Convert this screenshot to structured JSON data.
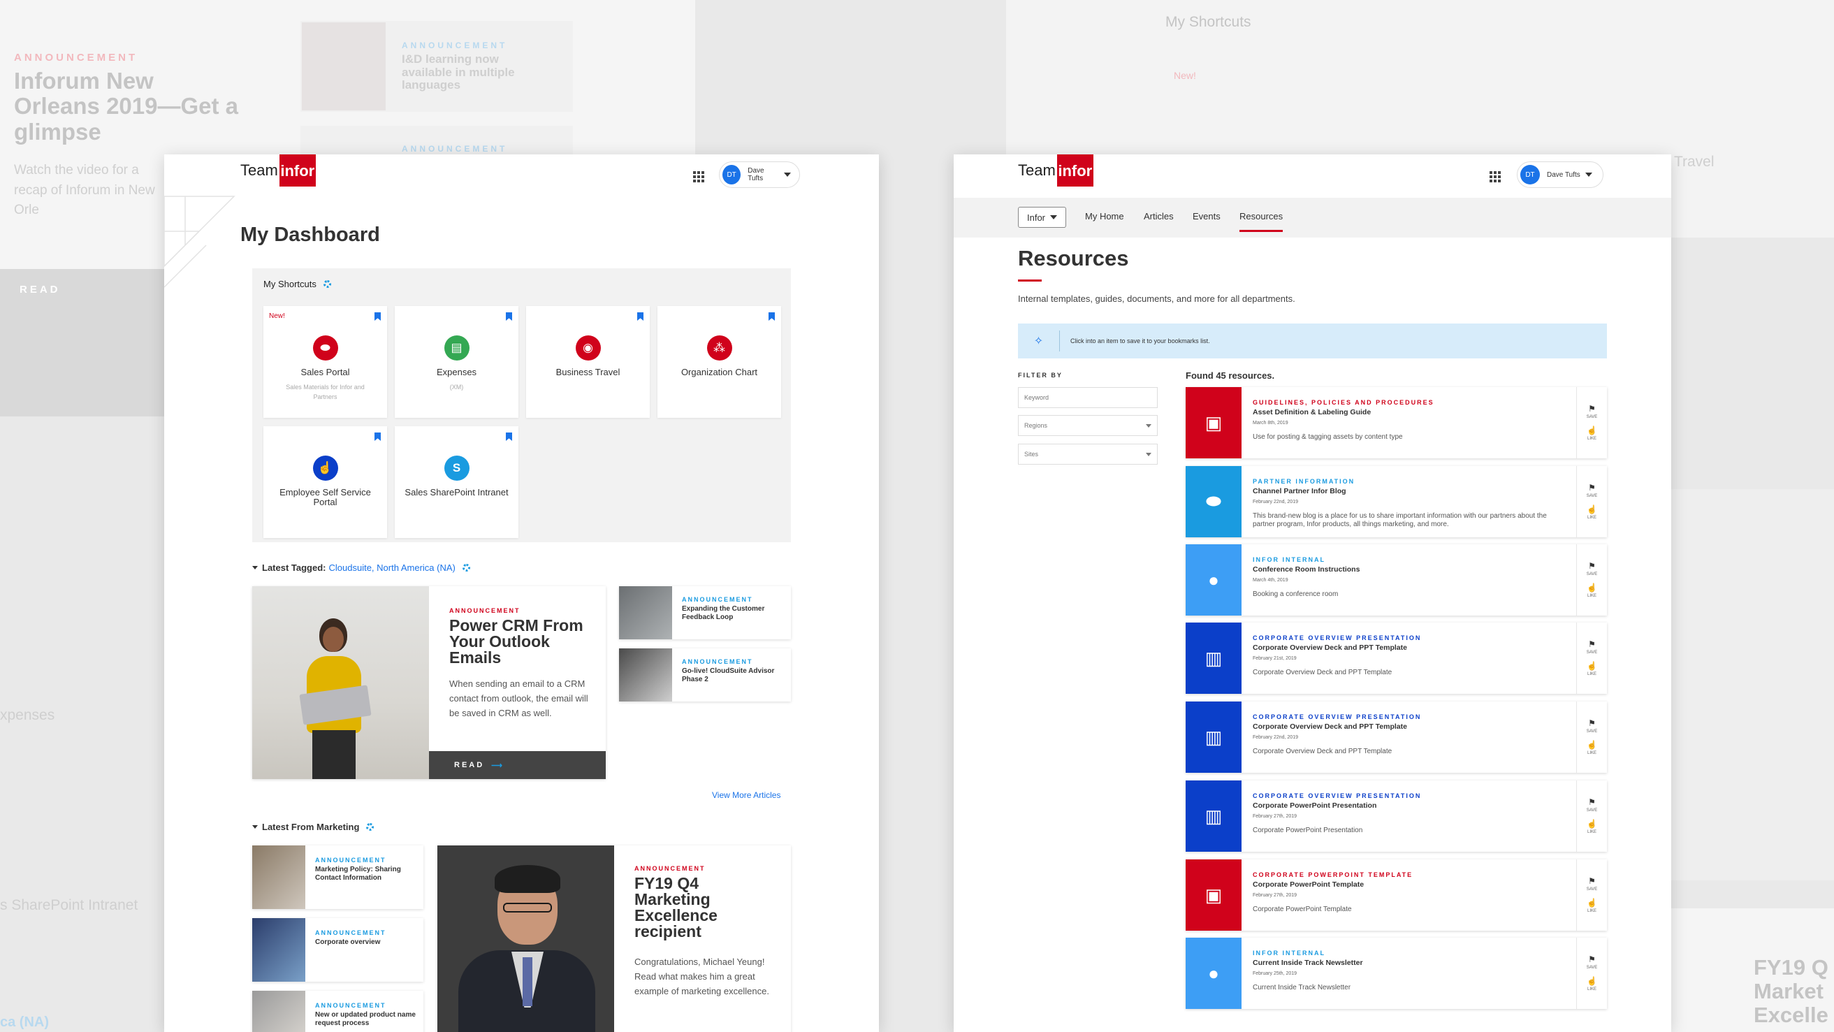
{
  "background": {
    "left_announcement": {
      "label": "ANNOUNCEMENT",
      "title": "Inforum New Orleans 2019—Get a glimpse",
      "body": "Watch the video for a recap of Inforum in New Orle",
      "read": "READ"
    },
    "middle_announcement_1": {
      "label": "ANNOUNCEMENT",
      "title": "I&D learning now available in multiple languages"
    },
    "middle_announcement_2": {
      "label": "ANNOUNCEMENT"
    },
    "right_shortcuts_title": "My Shortcuts",
    "right_new": "New!",
    "right_partial_travel": "s Travel",
    "left_partial_expenses": "xpenses",
    "left_partial_sharepoint": "s SharePoint Intranet",
    "left_partial_tag": "ca (NA)",
    "right_partial_fy19": "FY19 Q Market Excelle"
  },
  "dashboard": {
    "logo": {
      "team": "Team",
      "box": "infor"
    },
    "user": {
      "initials": "DT",
      "name": "Dave Tufts"
    },
    "title": "My Dashboard",
    "shortcuts": {
      "title": "My Shortcuts",
      "tiles": [
        {
          "label": "Sales Portal",
          "sub": "Sales Materials for Infor and Partners",
          "badge": "New!",
          "icon": "handshake-icon",
          "color": "#d0021b",
          "glyph": "⬬"
        },
        {
          "label": "Expenses",
          "sub": "(XM)",
          "icon": "receipt-icon",
          "color": "#34a853",
          "glyph": "▤"
        },
        {
          "label": "Business Travel",
          "sub": "",
          "icon": "passport-icon",
          "color": "#d0021b",
          "glyph": "◉"
        },
        {
          "label": "Organization Chart",
          "sub": "",
          "icon": "org-chart-icon",
          "color": "#d0021b",
          "glyph": "⁂"
        },
        {
          "label": "Employee Self Service Portal",
          "sub": "",
          "icon": "hand-pointer-icon",
          "color": "#0b3fc9",
          "glyph": "☝"
        },
        {
          "label": "Sales SharePoint Intranet",
          "sub": "",
          "icon": "sharepoint-icon",
          "color": "#1a9be0",
          "glyph": "S"
        }
      ]
    },
    "latest_tagged": {
      "label": "Latest Tagged:",
      "tags": "Cloudsuite, North America (NA)",
      "feature": {
        "announcement": "ANNOUNCEMENT",
        "title": "Power CRM From Your Outlook Emails",
        "body": "When sending an email to a CRM contact from outlook, the email will be saved in CRM as well.",
        "read": "READ"
      },
      "side": [
        {
          "announcement": "ANNOUNCEMENT",
          "title": "Expanding the Customer Feedback Loop"
        },
        {
          "announcement": "ANNOUNCEMENT",
          "title": "Go-live! CloudSuite Advisor Phase 2"
        }
      ],
      "view_more": "View More Articles"
    },
    "latest_marketing": {
      "label": "Latest From Marketing",
      "list": [
        {
          "announcement": "ANNOUNCEMENT",
          "title": "Marketing Policy: Sharing Contact Information"
        },
        {
          "announcement": "ANNOUNCEMENT",
          "title": "Corporate overview"
        },
        {
          "announcement": "ANNOUNCEMENT",
          "title": "New or updated product name request process"
        }
      ],
      "feature": {
        "announcement": "ANNOUNCEMENT",
        "title": "FY19 Q4 Marketing Excellence recipient",
        "body": "Congratulations, Michael Yeung! Read what makes him a great example of marketing excellence."
      }
    }
  },
  "resources": {
    "logo": {
      "team": "Team",
      "box": "infor"
    },
    "user": {
      "initials": "DT",
      "name": "Dave Tufts"
    },
    "nav": {
      "dropdown": "Infor",
      "items": [
        "My Home",
        "Articles",
        "Events",
        "Resources"
      ],
      "active": "Resources"
    },
    "title": "Resources",
    "description": "Internal templates, guides, documents, and more for all departments.",
    "tip": "Click into an item to save it to your bookmarks list.",
    "filter": {
      "label": "FILTER BY",
      "keyword_placeholder": "Keyword",
      "regions": "Regions",
      "sites": "Sites"
    },
    "found": "Found 45 resources.",
    "actions": {
      "save": "SAVE",
      "like": "LIKE"
    },
    "items": [
      {
        "category": "GUIDELINES, POLICIES AND PROCEDURES",
        "cat_color": "#d0021b",
        "name": "Asset Definition & Labeling Guide",
        "date": "March 8th, 2019",
        "desc": "Use for posting & tagging assets by content type",
        "icon": "briefcase-icon",
        "bg": "#d0021b",
        "glyph": "▣"
      },
      {
        "category": "PARTNER INFORMATION",
        "cat_color": "#1a9be0",
        "name": "Channel Partner Infor Blog",
        "date": "February 22nd, 2019",
        "desc": "This brand-new blog is a place for us to share important information with our partners about the partner program, Infor products, all things marketing, and more.",
        "icon": "handshake-icon",
        "bg": "#1a9be0",
        "glyph": "⬬"
      },
      {
        "category": "INFOR INTERNAL",
        "cat_color": "#1a9be0",
        "name": "Conference Room Instructions",
        "date": "March 4th, 2019",
        "desc": "Booking a conference room",
        "icon": "chat-bubble-icon",
        "bg": "#3d9ef5",
        "glyph": "●"
      },
      {
        "category": "CORPORATE OVERVIEW PRESENTATION",
        "cat_color": "#0b3fc9",
        "name": "Corporate Overview Deck and PPT Template",
        "date": "February 21st, 2019",
        "desc": "Corporate Overview Deck and PPT Template",
        "icon": "building-icon",
        "bg": "#0b3fc9",
        "glyph": "▥"
      },
      {
        "category": "CORPORATE OVERVIEW PRESENTATION",
        "cat_color": "#0b3fc9",
        "name": "Corporate Overview Deck and PPT Template",
        "date": "February 22nd, 2019",
        "desc": "Corporate Overview Deck and PPT Template",
        "icon": "building-icon",
        "bg": "#0b3fc9",
        "glyph": "▥"
      },
      {
        "category": "CORPORATE OVERVIEW PRESENTATION",
        "cat_color": "#0b3fc9",
        "name": "Corporate PowerPoint Presentation",
        "date": "February 27th, 2019",
        "desc": "Corporate PowerPoint Presentation",
        "icon": "building-icon",
        "bg": "#0b3fc9",
        "glyph": "▥"
      },
      {
        "category": "CORPORATE POWERPOINT TEMPLATE",
        "cat_color": "#d0021b",
        "name": "Corporate PowerPoint Template",
        "date": "February 27th, 2019",
        "desc": "Corporate PowerPoint Template",
        "icon": "briefcase-icon",
        "bg": "#d0021b",
        "glyph": "▣"
      },
      {
        "category": "INFOR INTERNAL",
        "cat_color": "#1a9be0",
        "name": "Current Inside Track Newsletter",
        "date": "February 25th, 2019",
        "desc": "Current Inside Track Newsletter",
        "icon": "chat-bubble-icon",
        "bg": "#3d9ef5",
        "glyph": "●"
      }
    ]
  }
}
